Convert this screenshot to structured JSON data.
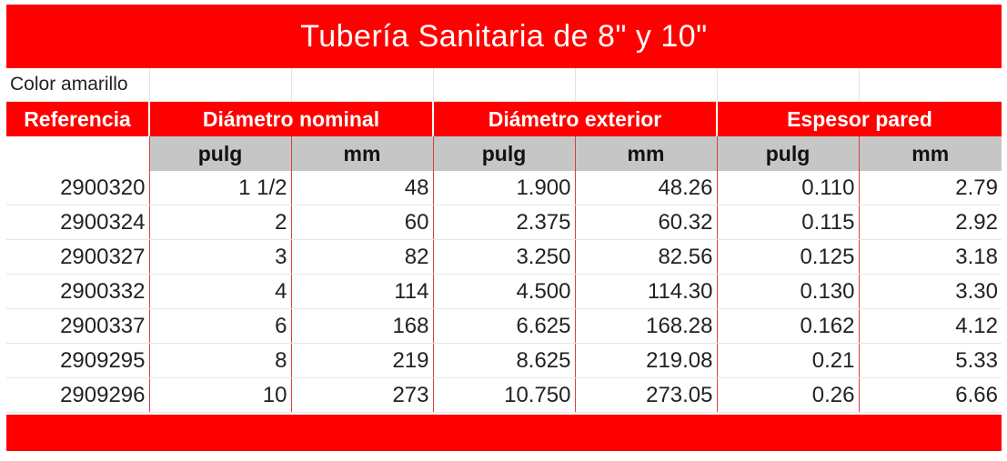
{
  "title": "Tubería Sanitaria de 8\" y 10\"",
  "subtitle": "Color amarillo",
  "headers": {
    "referencia": "Referencia",
    "diametro_nominal": "Diámetro nominal",
    "diametro_exterior": "Diámetro exterior",
    "espesor_pared": "Espesor pared"
  },
  "units": {
    "pulg": "pulg",
    "mm": "mm"
  },
  "colors": {
    "brand_red": "#ff0000",
    "unit_gray": "#c6c6c6"
  },
  "rows": [
    [
      "2900320",
      "1 1/2",
      "48",
      "1.900",
      "48.26",
      "0.110",
      "2.79"
    ],
    [
      "2900324",
      "2",
      "60",
      "2.375",
      "60.32",
      "0.115",
      "2.92"
    ],
    [
      "2900327",
      "3",
      "82",
      "3.250",
      "82.56",
      "0.125",
      "3.18"
    ],
    [
      "2900332",
      "4",
      "114",
      "4.500",
      "114.30",
      "0.130",
      "3.30"
    ],
    [
      "2900337",
      "6",
      "168",
      "6.625",
      "168.28",
      "0.162",
      "4.12"
    ],
    [
      "2909295",
      "8",
      "219",
      "8.625",
      "219.08",
      "0.21",
      "5.33"
    ],
    [
      "2909296",
      "10",
      "273",
      "10.750",
      "273.05",
      "0.26",
      "6.66"
    ]
  ]
}
